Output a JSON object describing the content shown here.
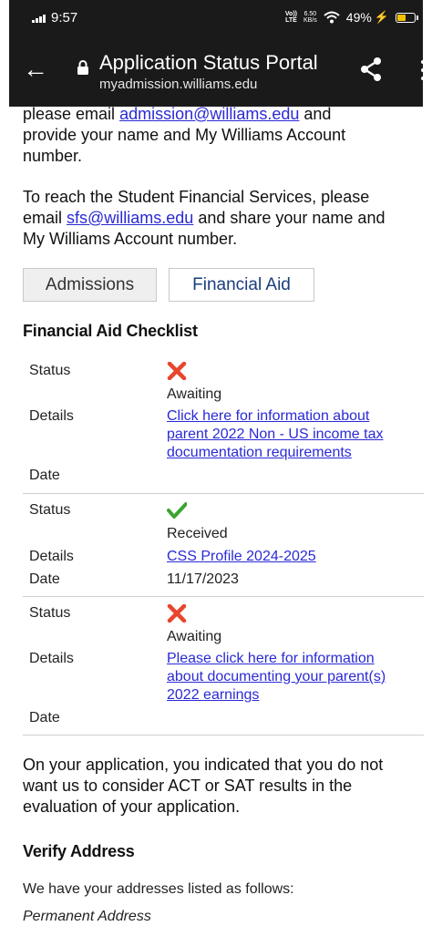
{
  "status_bar": {
    "time": "9:57",
    "volte_top": "Vo))",
    "volte_bottom": "LTE",
    "speed_value": "6.50",
    "speed_unit": "KB/s",
    "battery": "49%"
  },
  "app_bar": {
    "title": "Application Status Portal",
    "url": "myadmission.williams.edu"
  },
  "intro": {
    "line1_prefix": "please email ",
    "email1": "admission@williams.edu",
    "line1_suffix": " and",
    "line2": "provide your name and My Williams Account",
    "line3": "number.",
    "sfs_line1": "To reach the Student Financial Services, please",
    "sfs_prefix": "email ",
    "email2": "sfs@williams.edu",
    "sfs_suffix": " and share your name and",
    "sfs_line3": "My Williams Account number."
  },
  "tabs": [
    {
      "label": "Admissions"
    },
    {
      "label": "Financial Aid"
    }
  ],
  "checklist": {
    "title": "Financial Aid Checklist",
    "labels": {
      "status": "Status",
      "details": "Details",
      "date": "Date"
    },
    "items": [
      {
        "status_icon": "x-mark-icon",
        "status_text": "Awaiting",
        "details_lines": [
          "Click here for information about",
          "parent 2022 Non - US income tax",
          "documentation requirements"
        ],
        "date": ""
      },
      {
        "status_icon": "check-mark-icon",
        "status_text": "Received",
        "details_lines": [
          "CSS Profile 2024-2025"
        ],
        "date": "11/17/2023"
      },
      {
        "status_icon": "x-mark-icon",
        "status_text": "Awaiting",
        "details_lines": [
          "Please click here for information",
          "about documenting your parent(s)",
          "2022 earnings"
        ],
        "date": ""
      }
    ]
  },
  "test_note": {
    "line1": "On your application, you indicated that you do not",
    "line2": "want us to consider ACT or SAT results in the",
    "line3": "evaluation of your application."
  },
  "verify": {
    "title": "Verify Address",
    "text": "We have your addresses listed as follows:",
    "permanent_label": "Permanent Address"
  },
  "colors": {
    "topbar": "#1a1a1a",
    "link": "#2a2ad6",
    "awaiting_x": "#e8452c",
    "received_check": "#3aa52e",
    "battery": "#f2c200"
  }
}
